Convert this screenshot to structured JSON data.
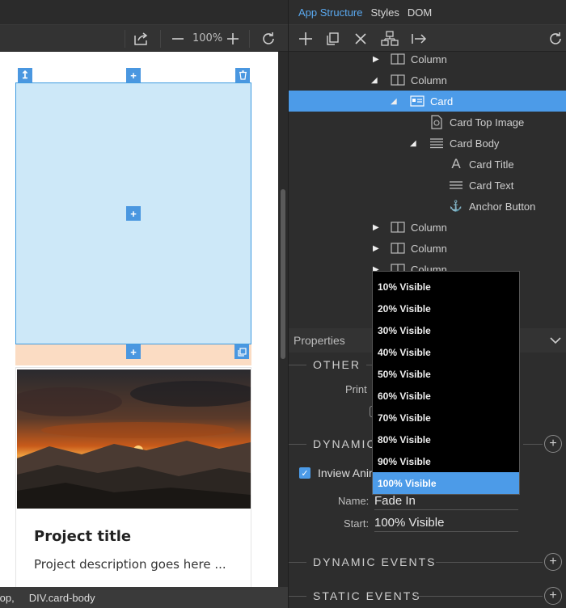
{
  "toolbar_left": {
    "zoom": "100%"
  },
  "canvas_card": {
    "title": "Project title",
    "text": "Project description goes here ..."
  },
  "statusbar": {
    "items": [
      "top,",
      "DIV.card-body"
    ]
  },
  "tabs": [
    "App Structure",
    "Styles",
    "DOM"
  ],
  "tree": [
    {
      "label": "Column",
      "icon": "column-icon",
      "arrow": "collapsed"
    },
    {
      "label": "Column",
      "icon": "column-icon",
      "arrow": "expanded"
    },
    {
      "label": "Card",
      "icon": "card-icon",
      "arrow": "expanded",
      "selected": true
    },
    {
      "label": "Card Top Image",
      "icon": "image-icon",
      "arrow": "none"
    },
    {
      "label": "Card Body",
      "icon": "body-lines-icon",
      "arrow": "expanded"
    },
    {
      "label": "Card Title",
      "icon": "text-a-icon",
      "arrow": "none"
    },
    {
      "label": "Card Text",
      "icon": "text-lines-icon",
      "arrow": "none"
    },
    {
      "label": "Anchor Button",
      "icon": "anchor-icon",
      "arrow": "none"
    },
    {
      "label": "Column",
      "icon": "column-icon",
      "arrow": "collapsed"
    },
    {
      "label": "Column",
      "icon": "column-icon",
      "arrow": "collapsed"
    },
    {
      "label": "Column",
      "icon": "column-icon",
      "arrow": "collapsed"
    }
  ],
  "properties": {
    "header": "Properties",
    "other_title": "OTHER",
    "print_label": "Print",
    "dynamic_title": "DYNAMIC",
    "inview_label": "Inview Animation",
    "name_label": "Name:",
    "name_value": "Fade In",
    "start_label": "Start:",
    "start_value": "100% Visible",
    "dynamic_events_title": "DYNAMIC EVENTS",
    "static_events_title": "STATIC EVENTS"
  },
  "dropdown": {
    "options": [
      "10% Visible",
      "20% Visible",
      "30% Visible",
      "40% Visible",
      "50% Visible",
      "60% Visible",
      "70% Visible",
      "80% Visible",
      "90% Visible",
      "100% Visible"
    ],
    "selected_index": 9
  },
  "colors": {
    "accent": "#4c9be8",
    "selection_fill": "#cde8f8",
    "peach": "#fbdcc3"
  }
}
